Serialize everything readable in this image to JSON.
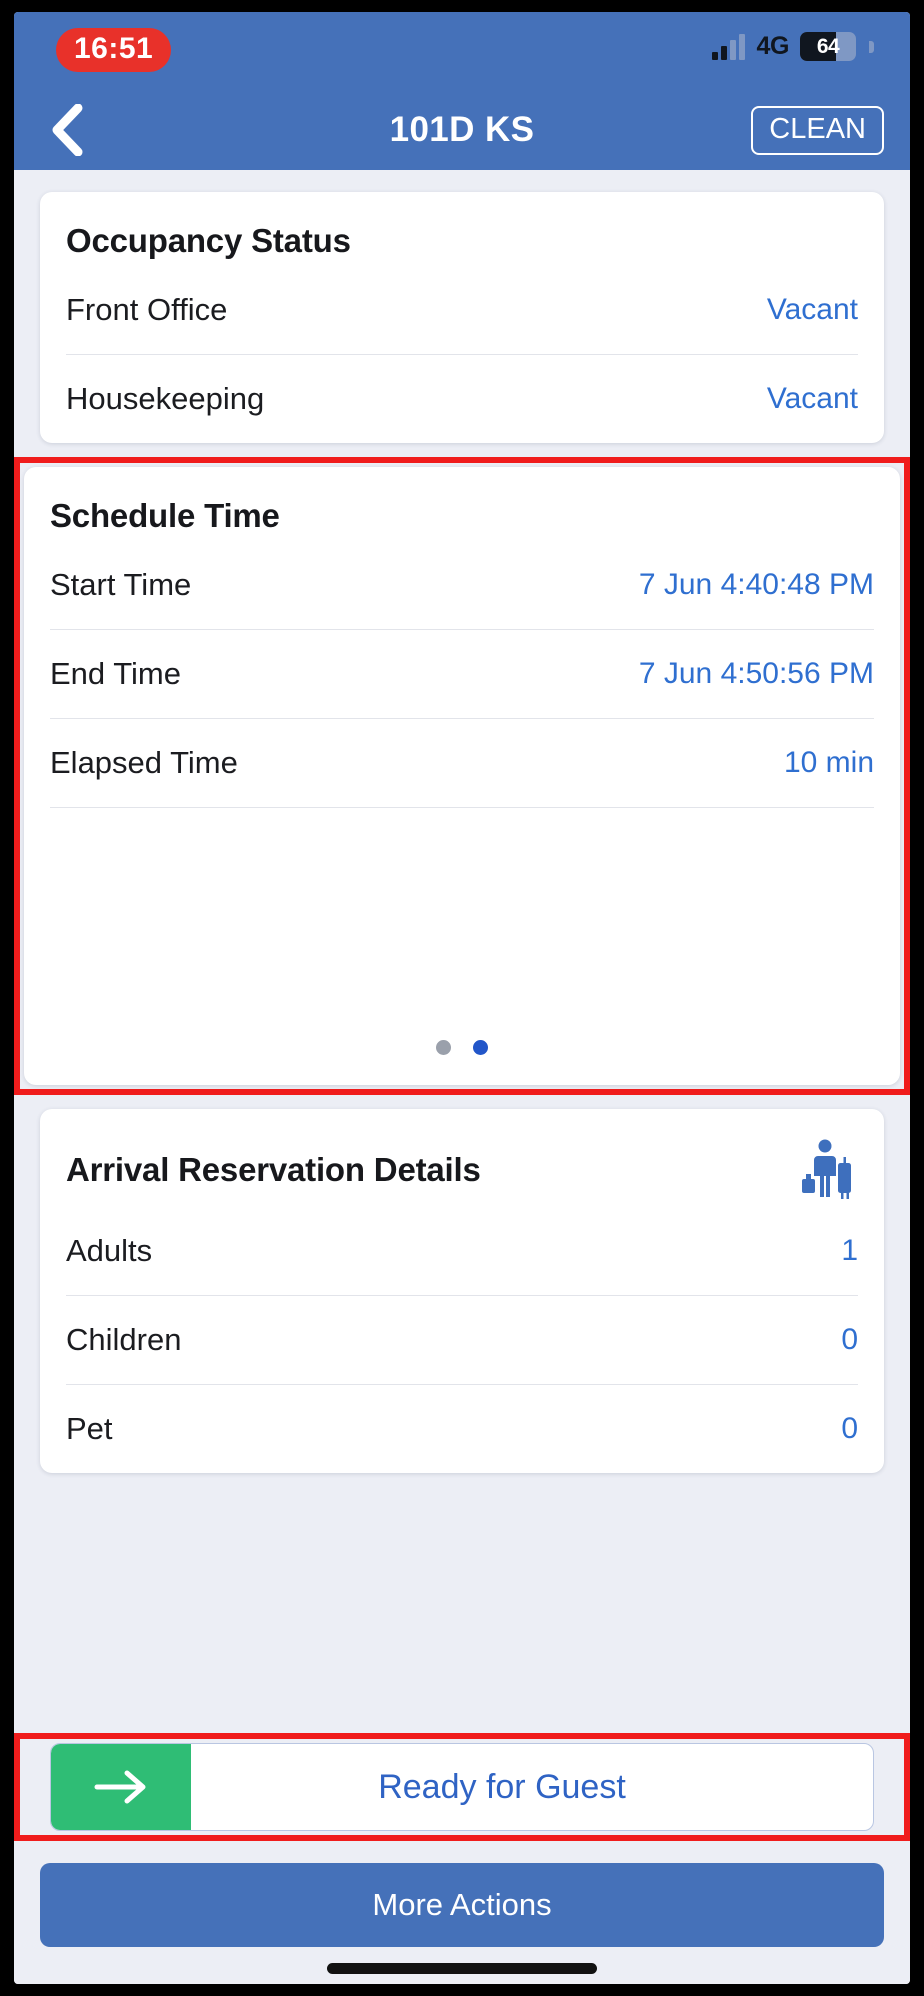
{
  "statusbar": {
    "time": "16:51",
    "network": "4G",
    "battery_percent": "64",
    "signal_icon": "signal-bars-icon",
    "battery_icon": "battery-icon"
  },
  "navbar": {
    "back_icon": "chevron-left-icon",
    "title": "101D KS",
    "status_action": "CLEAN"
  },
  "occupancy": {
    "title": "Occupancy Status",
    "rows": [
      {
        "label": "Front Office",
        "value": "Vacant"
      },
      {
        "label": "Housekeeping",
        "value": "Vacant"
      }
    ]
  },
  "schedule": {
    "title": "Schedule Time",
    "rows": [
      {
        "label": "Start Time",
        "value": "7 Jun 4:40:48 PM"
      },
      {
        "label": "End Time",
        "value": "7 Jun 4:50:56 PM"
      },
      {
        "label": "Elapsed Time",
        "value": "10 min"
      }
    ],
    "pager": {
      "count": 2,
      "active_index": 1
    }
  },
  "arrival": {
    "title": "Arrival Reservation Details",
    "icon": "traveler-luggage-icon",
    "rows": [
      {
        "label": "Adults",
        "value": "1"
      },
      {
        "label": "Children",
        "value": "0"
      },
      {
        "label": "Pet",
        "value": "0"
      }
    ]
  },
  "footer": {
    "ready_label": "Ready for Guest",
    "ready_icon": "arrow-right-icon",
    "more_actions_label": "More Actions"
  },
  "colors": {
    "brand_blue": "#4571b9",
    "accent_blue": "#2f6fd0",
    "green": "#2fbd75",
    "highlight_red": "#f01c1c",
    "clock_red": "#e8312a",
    "page_bg": "#eceef5"
  }
}
